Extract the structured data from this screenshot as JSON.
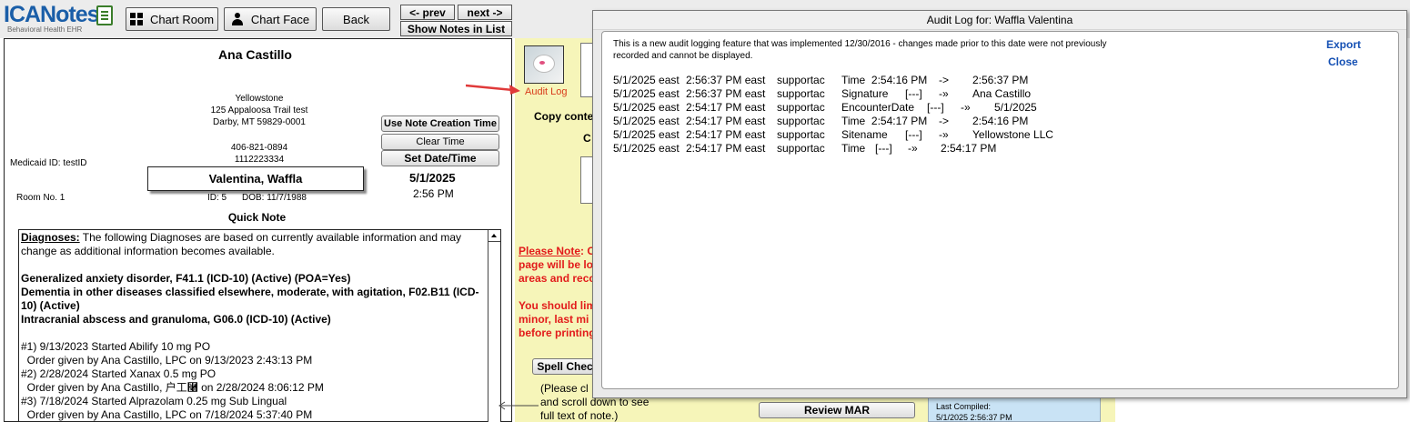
{
  "topbar": {
    "logo_text_main": "ICANotes",
    "logo_text_sub": "Behavioral Health EHR",
    "buttons": {
      "chart_room": "Chart Room",
      "chart_face": "Chart Face",
      "back": "Back",
      "prev": "<- prev",
      "next": "next ->",
      "show_notes": "Show Notes in List"
    }
  },
  "note": {
    "provider_name": "Ana Castillo",
    "address": {
      "line1": "Yellowstone",
      "line2": "125 Appaloosa Trail test",
      "line3": "Darby, MT 59829-0001",
      "phone": "406-821-0894",
      "fax": "1112223334"
    },
    "medicaid": "Medicaid ID: testID",
    "room": "Room No. 1",
    "patient_name": "Valentina, Waffla",
    "id_label": "ID: 5",
    "dob_label": "DOB: 11/7/1988",
    "date": "5/1/2025",
    "time": "2:56 PM",
    "buttons": {
      "use_note_creation": "Use Note Creation Time",
      "clear_time": "Clear Time",
      "set_datetime": "Set Date/Time"
    },
    "title": "Quick Note",
    "diagnoses_label": "Diagnoses:",
    "diagnoses_intro": " The following Diagnoses are based on currently available information and may change as additional information becomes available.",
    "diagnoses": [
      "Generalized anxiety disorder, F41.1 (ICD-10) (Active) (POA=Yes)",
      "Dementia in other diseases classified elsewhere, moderate, with agitation, F02.B11 (ICD-10) (Active)",
      "Intracranial abscess and granuloma, G06.0 (ICD-10) (Active)"
    ],
    "orders": [
      "#1) 9/13/2023 Started Abilify 10 mg PO",
      "  Order given by Ana Castillo, LPC on 9/13/2023 2:43:13 PM",
      "#2) 2/28/2024 Started Xanax 0.5 mg PO",
      "  Order given by Ana Castillo, ⼾⼯⿨ on 2/28/2024 8:06:12 PM",
      "#3) 7/18/2024 Started Alprazolam 0.25 mg Sub Lingual",
      "  Order given by Ana Castillo, LPC on 7/18/2024 5:37:40 PM"
    ]
  },
  "middle": {
    "audit_log_link": "Audit Log",
    "copy_content": "Copy conte",
    "c_label": "C",
    "please_note_label": "Please Note",
    "please_note_text": ": C",
    "note_lines": [
      "page will be lo",
      "areas and reco"
    ],
    "limit_lines": [
      "You should lim",
      "minor, last mi",
      "before printing"
    ],
    "spell_check": "Spell Chec",
    "scroll_hint": [
      "(Please cl",
      "and scroll down to see",
      "full text of note.)"
    ],
    "review_mar": "Review MAR",
    "last_compiled_label": "Last Compiled:",
    "last_compiled_value": "5/1/2025 2:56:37 PM"
  },
  "dialog": {
    "title": "Audit Log for: Waffla Valentina",
    "notice": "This is a new audit logging feature that was implemented 12/30/2016 - changes made prior to this date were not previously recorded and cannot be displayed.",
    "export": "Export",
    "close": "Close",
    "rows": [
      {
        "date": "5/1/2025 east",
        "time": "2:56:37 PM east",
        "user": "supportac",
        "field": "Time  2:54:16 PM",
        "arrow": "->",
        "value": "2:56:37 PM"
      },
      {
        "date": "5/1/2025 east",
        "time": "2:56:37 PM east",
        "user": "supportac",
        "field": "Signature",
        "old": "[---]",
        "arrow": "-»",
        "value": "Ana Castillo"
      },
      {
        "date": "5/1/2025 east",
        "time": "2:54:17 PM east",
        "user": "supportac",
        "field": "EncounterDate",
        "old": "[---]",
        "arrow": "-»",
        "value": "5/1/2025"
      },
      {
        "date": "5/1/2025 east",
        "time": "2:54:17 PM east",
        "user": "supportac",
        "field": "Time  2:54:17 PM",
        "arrow": "->",
        "value": "2:54:16 PM"
      },
      {
        "date": "5/1/2025 east",
        "time": "2:54:17 PM east",
        "user": "supportac",
        "field": "Sitename",
        "old": "[---]",
        "arrow": "-»",
        "value": "Yellowstone LLC"
      },
      {
        "date": "5/1/2025 east",
        "time": "2:54:17 PM east",
        "user": "supportac",
        "field": "Time",
        "old": "[---]",
        "arrow": "-»",
        "value": "2:54:17 PM"
      }
    ]
  },
  "colors": {
    "accent_blue": "#1450b4",
    "alert_red": "#e21b1b",
    "note_panel_yellow": "#f6f5b9",
    "compiled_blue": "#c9e3f5"
  }
}
